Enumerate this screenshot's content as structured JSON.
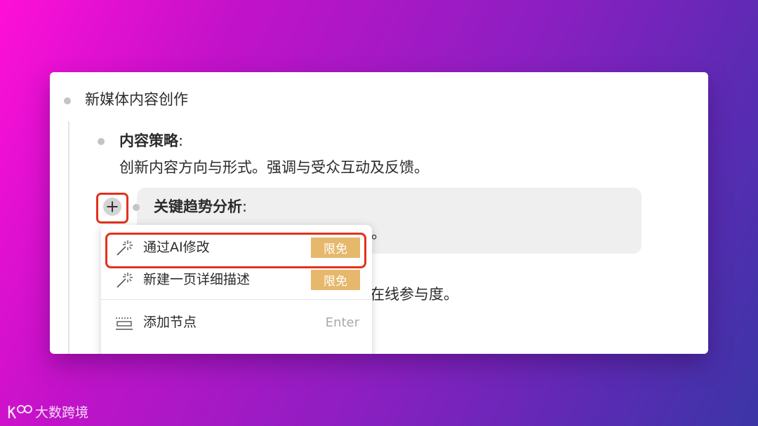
{
  "outline": {
    "root": {
      "text": "新媒体内容创作"
    },
    "content_strategy": {
      "title": "内容策略",
      "colon": ":",
      "body": "创新内容方向与形式。强调与受众互动及反馈。"
    },
    "trend_analysis": {
      "title": "关键趋势分析",
      "colon": ":",
      "body_partial": "展。"
    },
    "hidden_node": {
      "body_partial": "在线参与度。"
    }
  },
  "context_menu": {
    "items": [
      {
        "label": "通过AI修改",
        "badge": "限免",
        "icon": "magic-wand-icon"
      },
      {
        "label": "新建一页详细描述",
        "badge": "限免",
        "icon": "magic-wand-icon"
      },
      {
        "label": "添加节点",
        "shortcut": "Enter",
        "icon": "add-node-icon"
      }
    ]
  },
  "watermark": {
    "text": "大数跨境"
  },
  "colors": {
    "highlight_red": "#e3311e",
    "badge_gold": "#e6b86b",
    "node_highlight": "#efefef"
  }
}
